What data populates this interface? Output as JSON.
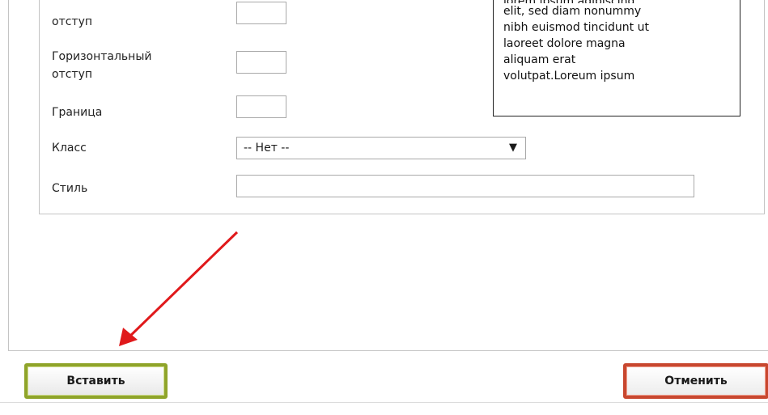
{
  "form": {
    "vspace_label": "отступ",
    "hspace_label": "Горизонтальный\nотступ",
    "hspace_label_line1": "Горизонтальный",
    "hspace_label_line2": "отступ",
    "border_label": "Граница",
    "class_label": "Класс",
    "class_selected": "-- Нет --",
    "style_label": "Стиль",
    "vspace_value": "",
    "hspace_value": "",
    "border_value": "",
    "style_value": ""
  },
  "preview": {
    "lines": [
      "elit, sed diam nonummy",
      "nibh euismod tincidunt ut",
      "laoreet dolore magna",
      "aliquam erat",
      "volutpat.Loreum ipsum"
    ]
  },
  "buttons": {
    "insert_label": "Вставить",
    "cancel_label": "Отменить"
  },
  "colors": {
    "insert_border": "#8fa42a",
    "cancel_border": "#c8472f",
    "annotation_arrow": "#e0191b"
  },
  "icons": {
    "select_arrow": "triangle-down-icon"
  }
}
